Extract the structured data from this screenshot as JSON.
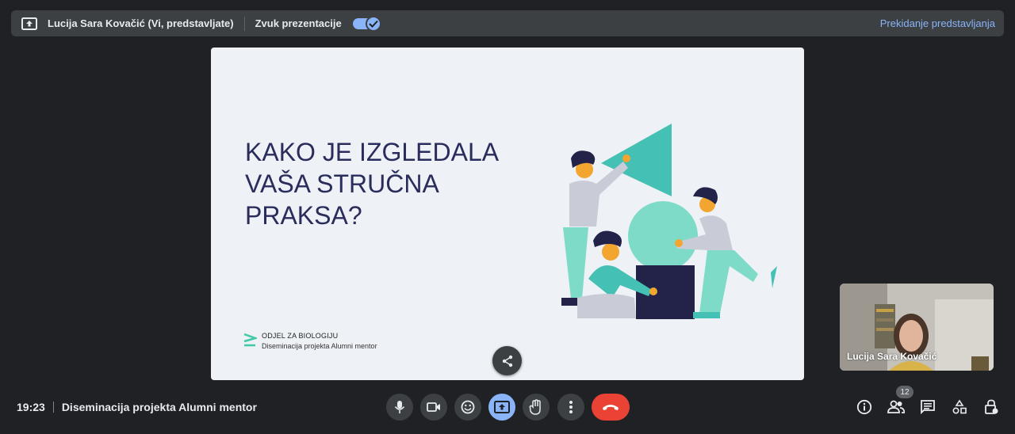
{
  "topbar": {
    "presenter": "Lucija Sara Kovačić (Vi, predstavljate)",
    "audio_label": "Zvuk prezentacije",
    "audio_enabled": true,
    "stop_label": "Prekidanje predstavljanja"
  },
  "slide": {
    "title_lines": [
      "KAKO JE IZGLEDALA",
      "VAŠA STRUČNA",
      "PRAKSA?"
    ],
    "logo_line1": "ODJEL ZA BIOLOGIJU",
    "logo_line2": "Diseminacija projekta Alumni mentor"
  },
  "selfview": {
    "name": "Lucija Sara Kovačić"
  },
  "bottom": {
    "time": "19:23",
    "meeting_name": "Diseminacija projekta Alumni mentor",
    "participants_count": "12"
  },
  "controls": [
    {
      "icon": "microphone-icon"
    },
    {
      "icon": "camera-icon"
    },
    {
      "icon": "emoji-icon"
    },
    {
      "icon": "present-screen-icon"
    },
    {
      "icon": "raise-hand-icon"
    },
    {
      "icon": "more-options-icon"
    },
    {
      "icon": "end-call-icon"
    }
  ],
  "colors": {
    "background": "#202124",
    "accent": "#8ab4f8",
    "end_call": "#ea4335",
    "slide_title": "#2a2d5c",
    "teal": "#45c0b4"
  }
}
